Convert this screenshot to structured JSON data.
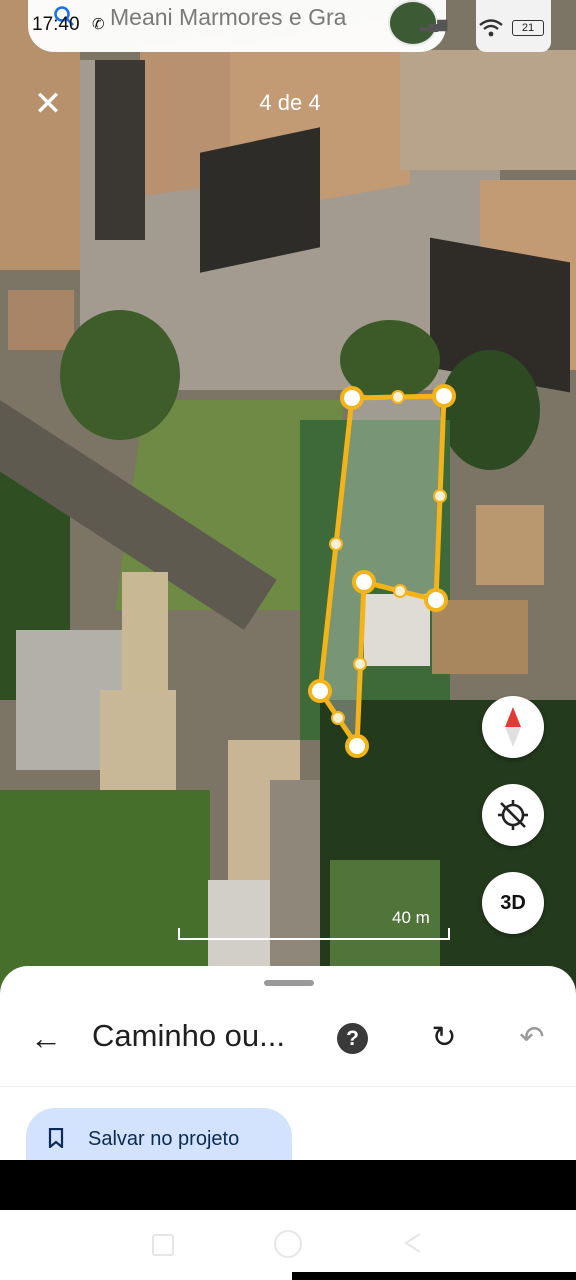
{
  "status": {
    "time": "17:40",
    "battery": "21"
  },
  "search": {
    "query": "Meani Marmores e Gra"
  },
  "viewer": {
    "counter": "4 de 4"
  },
  "map": {
    "scale_label": "40 m",
    "button_3d": "3D"
  },
  "sheet": {
    "title": "Caminho ou...",
    "save_label": "Salvar no projeto"
  },
  "colors": {
    "path": "#f3b41a",
    "accent_chip": "#d3e3fd",
    "compass_red": "#e53935"
  },
  "icons": [
    "search-icon",
    "whatsapp-icon",
    "close-icon",
    "compass-icon",
    "location-off-icon",
    "back-arrow-icon",
    "help-icon",
    "redo-icon",
    "undo-icon",
    "bookmark-icon"
  ]
}
